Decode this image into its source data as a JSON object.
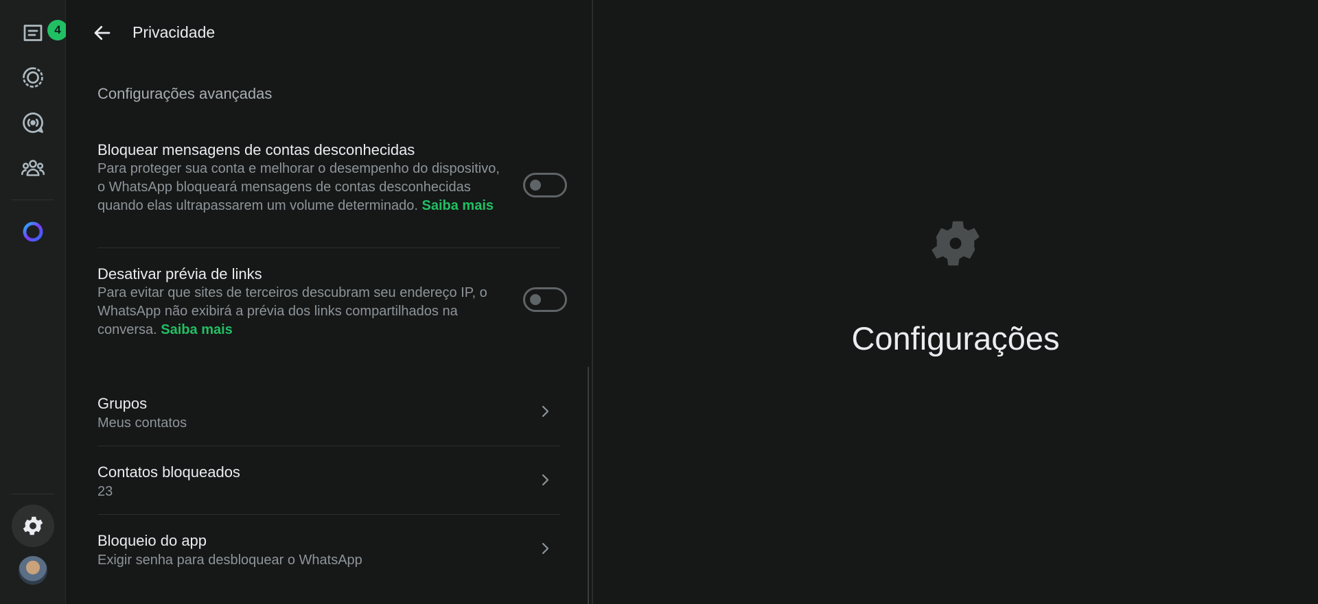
{
  "rail": {
    "chats_badge": "4",
    "icons": [
      "chats-icon",
      "status-icon",
      "channels-icon",
      "communities-icon",
      "meta-ai-icon",
      "settings-icon",
      "profile-avatar"
    ]
  },
  "header": {
    "title": "Privacidade"
  },
  "section": {
    "title": "Configurações avançadas"
  },
  "toggles": [
    {
      "title": "Bloquear mensagens de contas desconhecidas",
      "desc": "Para proteger sua conta e melhorar o desempenho do dispositivo, o WhatsApp bloqueará mensagens de contas desconhecidas quando elas ultrapassarem um volume determinado.",
      "learn_more": "Saiba mais",
      "enabled": false
    },
    {
      "title": "Desativar prévia de links",
      "desc": "Para evitar que sites de terceiros descubram seu endereço IP, o WhatsApp não exibirá a prévia dos links compartilhados na conversa.",
      "learn_more": "Saiba mais",
      "enabled": false
    }
  ],
  "nav": [
    {
      "title": "Grupos",
      "sub": "Meus contatos"
    },
    {
      "title": "Contatos bloqueados",
      "sub": "23"
    },
    {
      "title": "Bloqueio do app",
      "sub": "Exigir senha para desbloquear o WhatsApp"
    }
  ],
  "main": {
    "title": "Configurações"
  },
  "colors": {
    "accent": "#21c063",
    "background": "#161717",
    "rail": "#1d1f1f"
  }
}
